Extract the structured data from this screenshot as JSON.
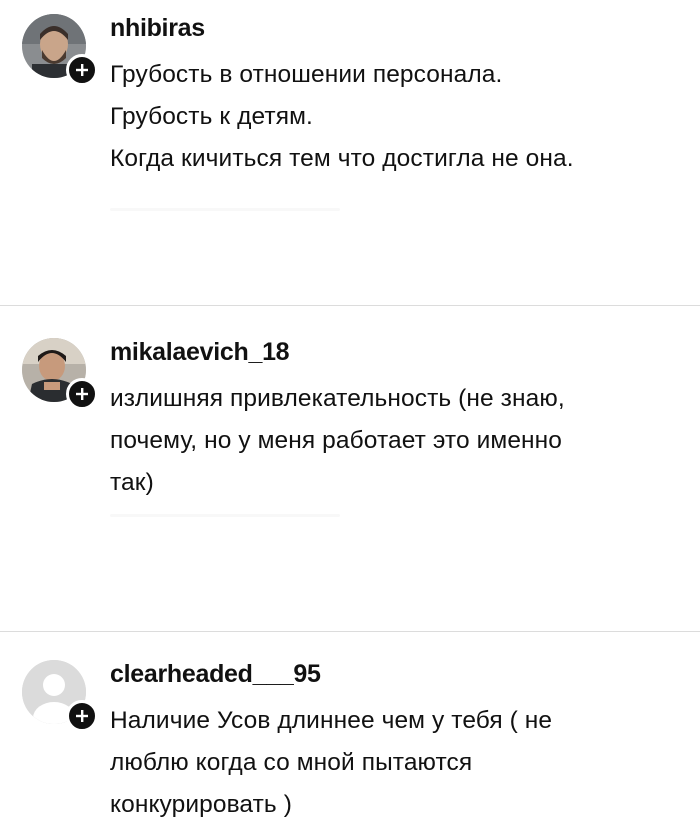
{
  "comments": [
    {
      "username": "nhibiras",
      "text": "Грубость в отношении персонала.\nГрубость к детям.\nКогда кичиться тем что достигла не она.",
      "avatar": "photo-man-beard",
      "badge_icon": "plus-icon"
    },
    {
      "username": "mikalaevich_18",
      "text": "излишняя привлекательность (не знаю,\nпочему, но у меня работает это именно\nтак)",
      "avatar": "photo-man-dark",
      "badge_icon": "plus-icon"
    },
    {
      "username": "clearheaded___95",
      "text": "Наличие Усов длиннее чем у тебя ( не\nлюблю когда со мной пытаются\nконкурировать )",
      "avatar": "default-avatar-icon",
      "badge_icon": "plus-icon"
    }
  ],
  "colors": {
    "text": "#111111",
    "divider": "#dcdcdc",
    "badge": "#111111",
    "default_avatar_bg": "#dbdbdb"
  }
}
